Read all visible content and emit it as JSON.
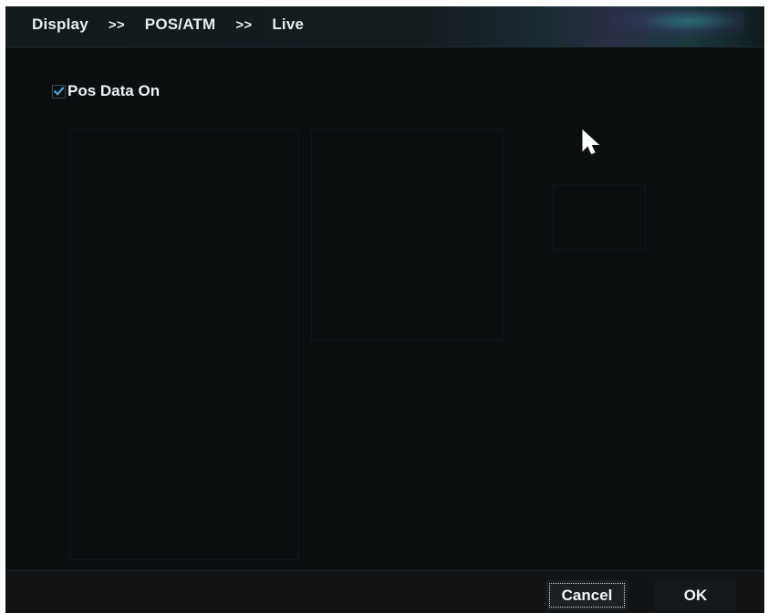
{
  "breadcrumb": {
    "items": [
      "Display",
      "POS/ATM",
      "Live"
    ],
    "separator": ">>"
  },
  "options": {
    "pos_data_on": {
      "label": "Pos Data On",
      "checked": true
    }
  },
  "footer": {
    "cancel_label": "Cancel",
    "ok_label": "OK"
  },
  "colors": {
    "background": "#0b0f10",
    "check_accent": "#4fa3e0",
    "text": "#eef3f5"
  },
  "icons": {
    "checkmark": "checkmark-icon",
    "cursor": "mouse-pointer-icon"
  }
}
